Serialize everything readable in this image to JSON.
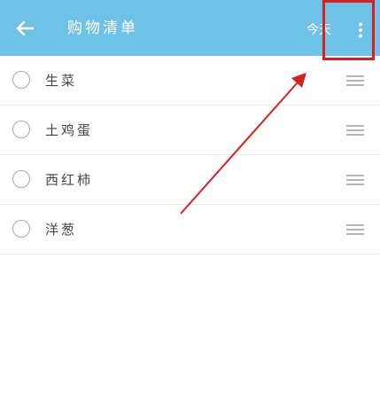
{
  "header": {
    "title": "购物清单",
    "today_label": "今天",
    "back_icon": "arrow-left-icon",
    "more_icon": "more-vertical-icon"
  },
  "items": [
    {
      "label": "生菜",
      "checked": false
    },
    {
      "label": "土鸡蛋",
      "checked": false
    },
    {
      "label": "西红柿",
      "checked": false
    },
    {
      "label": "洋葱",
      "checked": false
    }
  ],
  "colors": {
    "app_bar": "#6ec2e7",
    "annotation": "#d9201e"
  }
}
